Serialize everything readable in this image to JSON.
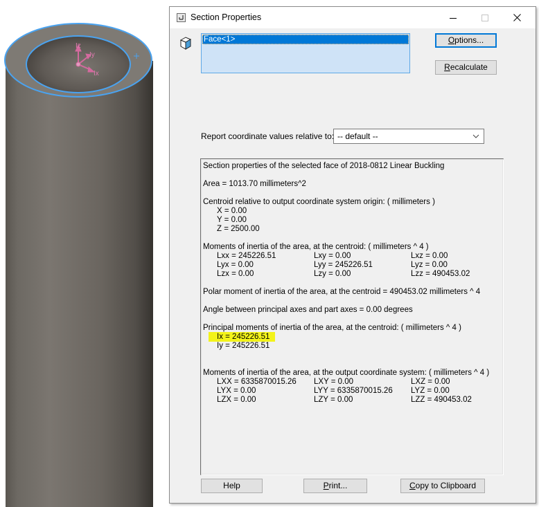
{
  "window": {
    "title": "Section Properties",
    "controls": {
      "minimize": "minimize",
      "maximize": "maximize",
      "close": "close"
    }
  },
  "viewport": {
    "triad_labels": {
      "z": "Iz",
      "y": "Iy",
      "x": "Ix"
    },
    "colors": {
      "edge_highlight": "#4aa3f0",
      "triad": "#d46a9e",
      "body_light": "#7c7770",
      "body_dark": "#3b3733"
    }
  },
  "selection": {
    "items": [
      "Face<1>"
    ],
    "selected_index": 0
  },
  "buttons": {
    "options": {
      "label": "Options...",
      "mnemonic": "O",
      "rest": "ptions..."
    },
    "recalculate": {
      "label": "Recalculate",
      "mnemonic": "R",
      "rest": "ecalculate"
    },
    "help": {
      "label": "Help"
    },
    "print": {
      "label": "Print...",
      "mnemonic": "P",
      "rest": "rint..."
    },
    "copy": {
      "label": "Copy to Clipboard",
      "mnemonic": "C",
      "rest": "opy to Clipboard"
    }
  },
  "coordinate": {
    "label": "Report coordinate values relative to:",
    "selected": "-- default --"
  },
  "results": {
    "header": "Section properties of the selected face of 2018-0812 Linear Buckling",
    "area": "Area = 1013.70 millimeters^2",
    "centroid_title": "Centroid relative to output coordinate system origin: ( millimeters )",
    "centroid": [
      "X = 0.00",
      "Y = 0.00",
      "Z = 2500.00"
    ],
    "moi_centroid_title": "Moments of inertia of the area, at the centroid: ( millimeters ^ 4 )",
    "moi_centroid": [
      [
        "Lxx = 245226.51",
        "Lxy = 0.00",
        "Lxz = 0.00"
      ],
      [
        "Lyx = 0.00",
        "Lyy = 245226.51",
        "Lyz = 0.00"
      ],
      [
        "Lzx = 0.00",
        "Lzy = 0.00",
        "Lzz = 490453.02"
      ]
    ],
    "polar": "Polar moment of inertia of the area, at the centroid = 490453.02 millimeters ^ 4",
    "angle": "Angle between principal axes and part axes = 0.00 degrees",
    "principal_title": "Principal moments of inertia of the area, at the centroid: ( millimeters ^ 4 )",
    "principal": [
      "Ix = 245226.51",
      "Iy = 245226.51"
    ],
    "highlight_color": "#f3f31a",
    "moi_output_title": "Moments of inertia of the area, at the output coordinate system: ( millimeters ^ 4 )",
    "moi_output": [
      [
        "LXX = 6335870015.26",
        "LXY = 0.00",
        "LXZ = 0.00"
      ],
      [
        "LYX = 0.00",
        "LYY = 6335870015.26",
        "LYZ = 0.00"
      ],
      [
        "LZX = 0.00",
        "LZY = 0.00",
        "LZZ = 490453.02"
      ]
    ]
  }
}
